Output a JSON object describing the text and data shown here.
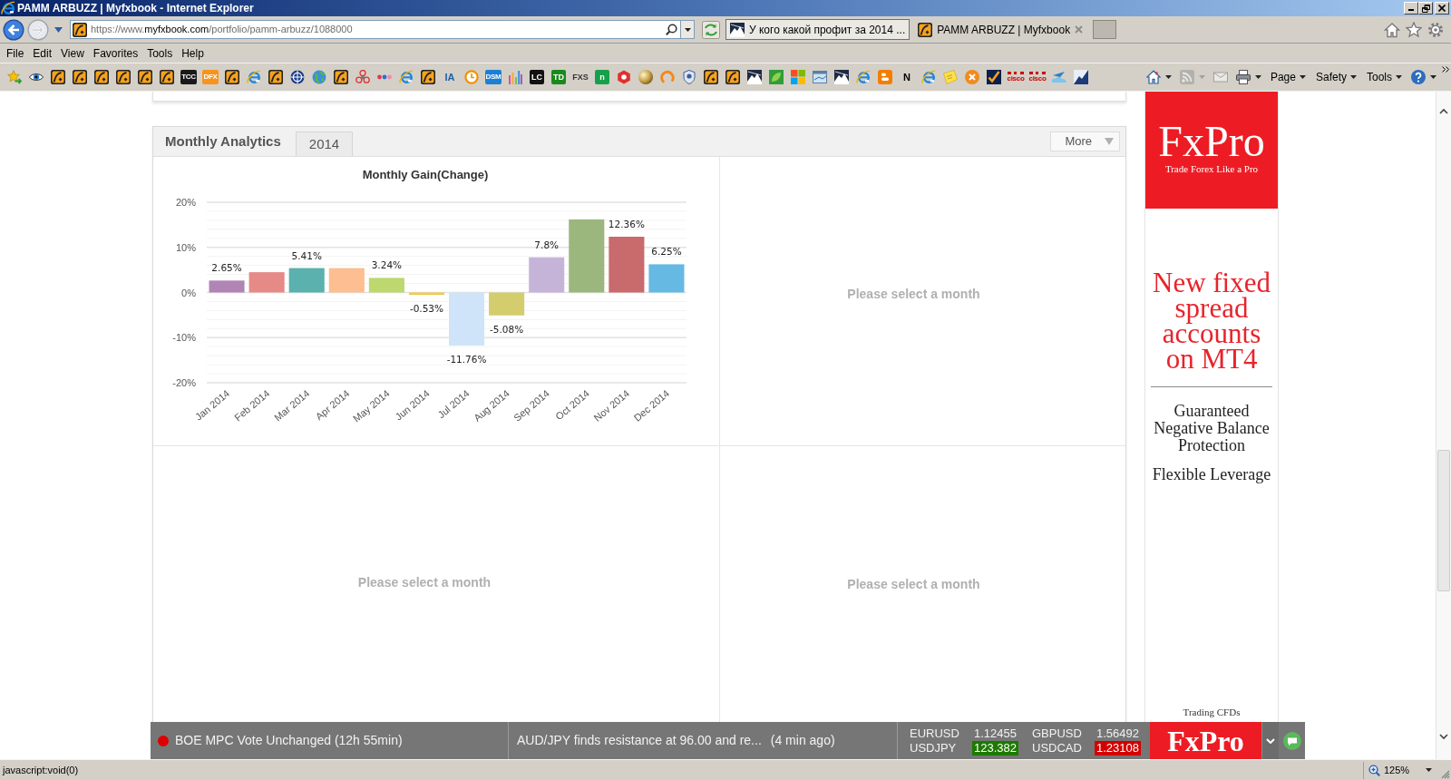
{
  "window": {
    "title": "PAMM ARBUZZ | Myfxbook - Internet Explorer"
  },
  "address_bar": {
    "url_parts": [
      {
        "text": "https://www.",
        "kind": "dim"
      },
      {
        "text": "myfxbook.com",
        "kind": "domain"
      },
      {
        "text": "/portfolio/pamm-arbuzz/1088000",
        "kind": "dim"
      }
    ]
  },
  "tabs": [
    {
      "label": "У кого какой профит за 2014 ...",
      "selected": false,
      "kind": "forum"
    },
    {
      "label": "PAMM ARBUZZ | Myfxbook",
      "selected": true,
      "kind": "site"
    }
  ],
  "menu_bar": [
    "File",
    "Edit",
    "View",
    "Favorites",
    "Tools",
    "Help"
  ],
  "favorites_bar": {
    "items": [
      {
        "kind": "star"
      },
      {
        "kind": "eye"
      },
      {
        "kind": "fx"
      },
      {
        "kind": "fx"
      },
      {
        "kind": "fx"
      },
      {
        "kind": "fx"
      },
      {
        "kind": "fx"
      },
      {
        "kind": "fx"
      },
      {
        "kind": "tile",
        "label": "TCC",
        "color": "#1a1a1a"
      },
      {
        "kind": "tile",
        "label": "DFX",
        "color": "#f7941d"
      },
      {
        "kind": "fx"
      },
      {
        "kind": "ie"
      },
      {
        "kind": "fx"
      },
      {
        "kind": "target"
      },
      {
        "kind": "globe"
      },
      {
        "kind": "fx"
      },
      {
        "kind": "flower"
      },
      {
        "kind": "dots"
      },
      {
        "kind": "ie"
      },
      {
        "kind": "fx"
      },
      {
        "kind": "wordmark",
        "label": "IA",
        "color": "#1f5fa8"
      },
      {
        "kind": "clock"
      },
      {
        "kind": "tile",
        "label": "DSM",
        "color": "#1b7fd6"
      },
      {
        "kind": "bars"
      },
      {
        "kind": "tile",
        "label": "LC",
        "color": "#111111"
      },
      {
        "kind": "tile",
        "label": "TD",
        "color": "#1a8a1a"
      },
      {
        "kind": "wordmark",
        "label": "FXS",
        "color": "#333333"
      },
      {
        "kind": "tile",
        "label": "n",
        "color": "#17a04a"
      },
      {
        "kind": "hexagon"
      },
      {
        "kind": "ball"
      },
      {
        "kind": "swirl"
      },
      {
        "kind": "shield"
      },
      {
        "kind": "fx"
      },
      {
        "kind": "fx"
      },
      {
        "kind": "mountain"
      },
      {
        "kind": "leaf"
      },
      {
        "kind": "windows"
      },
      {
        "kind": "monitor"
      },
      {
        "kind": "mountain"
      },
      {
        "kind": "ie"
      },
      {
        "kind": "blogger"
      },
      {
        "kind": "wordmark",
        "label": "N",
        "color": "#000000"
      },
      {
        "kind": "ie"
      },
      {
        "kind": "note"
      },
      {
        "kind": "xcircle"
      },
      {
        "kind": "check"
      },
      {
        "kind": "wordmark",
        "label": "cisco",
        "color": "#cc0000"
      },
      {
        "kind": "wordmark",
        "label": "cisco",
        "color": "#cc0000"
      },
      {
        "kind": "plane"
      },
      {
        "kind": "chart"
      }
    ],
    "commands": [
      {
        "kind": "home",
        "dropdown": true,
        "disabled": false
      },
      {
        "kind": "feeds",
        "dropdown": true,
        "disabled": true
      },
      {
        "kind": "mail",
        "dropdown": false,
        "disabled": true
      },
      {
        "kind": "print",
        "dropdown": true,
        "disabled": false
      },
      {
        "kind": "menu",
        "label": "Page"
      },
      {
        "kind": "menu",
        "label": "Safety"
      },
      {
        "kind": "menu",
        "label": "Tools"
      },
      {
        "kind": "help",
        "dropdown": true,
        "disabled": false
      }
    ]
  },
  "page": {
    "panel": {
      "title": "Monthly Analytics",
      "tabs": [
        {
          "label": "2014",
          "selected": true
        }
      ],
      "more_button": "More",
      "chart_data": {
        "type": "bar",
        "title": "Monthly Gain(Change)",
        "categories": [
          "Jan 2014",
          "Feb 2014",
          "Mar 2014",
          "Apr 2014",
          "May 2014",
          "Jun 2014",
          "Jul 2014",
          "Aug 2014",
          "Sep 2014",
          "Oct 2014",
          "Nov 2014",
          "Dec 2014"
        ],
        "values": [
          2.65,
          4.5,
          5.41,
          5.4,
          3.24,
          -0.53,
          -11.76,
          -5.08,
          7.8,
          16.2,
          12.36,
          6.25
        ],
        "colors": [
          "#b085b5",
          "#e58a87",
          "#5ab1ae",
          "#fdbe91",
          "#bcd86e",
          "#f2c94c",
          "#cfe4f8",
          "#d3cd6e",
          "#c6b4d8",
          "#9bb77d",
          "#c96a6c",
          "#66b9e2"
        ],
        "ylim": [
          -20,
          20
        ],
        "yticks": [
          {
            "value": 20,
            "label": "20%"
          },
          {
            "value": 10,
            "label": "10%"
          },
          {
            "value": 0,
            "label": "0%"
          },
          {
            "value": -10,
            "label": "-10%"
          },
          {
            "value": -20,
            "label": "-20%"
          }
        ],
        "grid": true,
        "value_labels": [
          "2.65%",
          null,
          "5.41%",
          null,
          "3.24%",
          "-0.53%",
          "-11.76%",
          "-5.08%",
          "7.8%",
          null,
          "12.36%",
          "6.25%"
        ]
      },
      "placeholders": [
        "Please select a month",
        "Please select a month",
        "Please select a month"
      ]
    },
    "ad": {
      "logo": "FxPro",
      "tagline": "Trade Forex Like a Pro",
      "headline": "New fixed spread accounts on MT4",
      "features": [
        "Guaranteed Negative Balance Protection",
        "Flexible Leverage"
      ],
      "footer": "Trading CFDs"
    }
  },
  "ticker": {
    "items": [
      {
        "kind": "event",
        "text": "BOE MPC Vote Unchanged (12h 55min)"
      },
      {
        "kind": "news",
        "text": "AUD/JPY finds resistance at 96.00 and re...",
        "age": "(4 min ago)"
      }
    ],
    "quotes": [
      {
        "symbol": "EURUSD",
        "price": "1.12455"
      },
      {
        "symbol": "GBPUSD",
        "price": "1.56492"
      },
      {
        "symbol": "USDJPY",
        "price": "123.382",
        "color": "#1d7a00"
      },
      {
        "symbol": "USDCAD",
        "price": "1.23108",
        "color": "#d40000"
      }
    ],
    "logo": "FxPro"
  },
  "status_bar": {
    "text": "javascript:void(0)",
    "zoom": "125%"
  }
}
